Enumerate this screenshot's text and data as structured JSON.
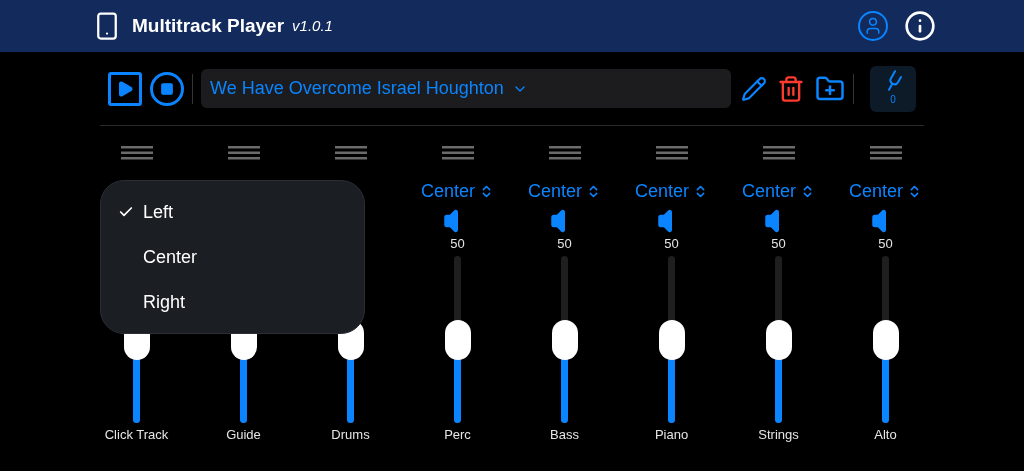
{
  "header": {
    "title": "Multitrack Player",
    "version": "v1.0.1"
  },
  "toolbar": {
    "song": "We Have Overcome Israel Houghton",
    "transpose": "0"
  },
  "tracks": [
    {
      "name": "Click Track",
      "level": 0.5
    },
    {
      "name": "Guide",
      "level": 0.5
    },
    {
      "name": "Drums",
      "level": 0.5
    },
    {
      "name": "Perc",
      "pan": "Center",
      "volume": "50",
      "level": 0.5
    },
    {
      "name": "Bass",
      "pan": "Center",
      "volume": "50",
      "level": 0.5
    },
    {
      "name": "Piano",
      "pan": "Center",
      "volume": "50",
      "level": 0.5
    },
    {
      "name": "Strings",
      "pan": "Center",
      "volume": "50",
      "level": 0.5
    },
    {
      "name": "Alto",
      "pan": "Center",
      "volume": "50",
      "level": 0.5
    }
  ],
  "pan_menu": [
    {
      "label": "Left",
      "selected": true
    },
    {
      "label": "Center",
      "selected": false
    },
    {
      "label": "Right",
      "selected": false
    }
  ]
}
